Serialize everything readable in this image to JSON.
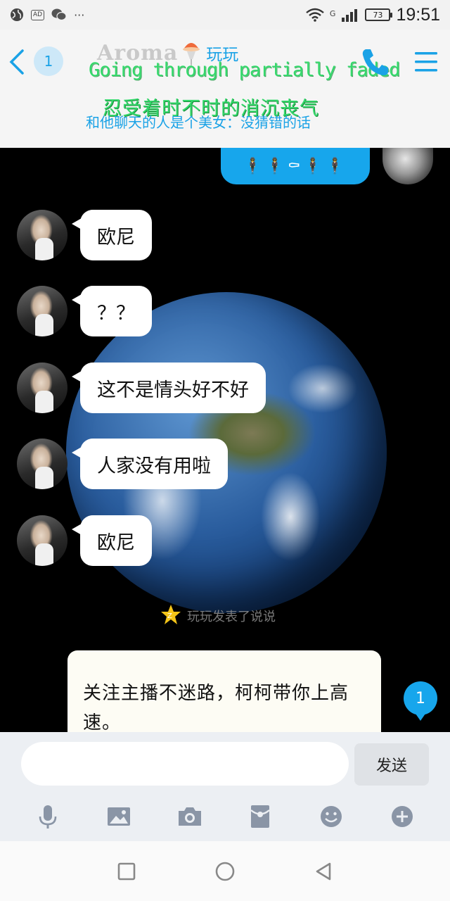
{
  "status_bar": {
    "icons": [
      "globe-icon",
      "ad-icon",
      "wechat-icon",
      "more-dots-icon"
    ],
    "ad_label": "AD",
    "more": "···",
    "network_type": "G",
    "battery_level": "73",
    "time": "19:51"
  },
  "header": {
    "unread_count": "1",
    "brand_text": "Aroma",
    "contact_name": "玩玩",
    "lyric_line_1": "Going through partially faded",
    "lyric_line_2": "忍受着时不时的消沉丧气",
    "subtitle": "和他聊天的人是个美女：没猜错的话"
  },
  "chat": {
    "sent_message": "🕴🕴⚰🕴🕴",
    "messages": [
      {
        "text": "欧尼"
      },
      {
        "text": "？？"
      },
      {
        "text": "这不是情头好不好"
      },
      {
        "text": "人家没有用啦"
      },
      {
        "text": "欧尼"
      }
    ],
    "zone_note": "玩玩发表了说说",
    "card_text": "关注主播不迷路，柯柯带你上高速。",
    "float_badge": "1"
  },
  "input": {
    "placeholder": "",
    "value": "",
    "send_label": "发送"
  },
  "toolbar": {
    "items": [
      "microphone-icon",
      "image-icon",
      "camera-icon",
      "red-packet-icon",
      "emoji-icon",
      "plus-icon"
    ]
  },
  "colors": {
    "accent": "#17a6ec",
    "lyric": "#33d86a",
    "chat_background": "#000000"
  }
}
